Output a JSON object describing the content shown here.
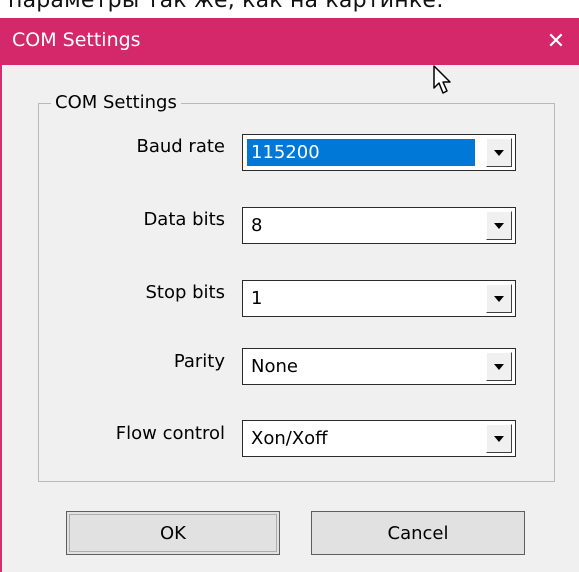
{
  "background_text": "параметры так же, как на картинке:",
  "window": {
    "title": "COM Settings",
    "close_glyph": "✕",
    "accent_color": "#d4286a"
  },
  "group": {
    "label": "COM Settings"
  },
  "fields": [
    {
      "label": "Baud rate",
      "value": "115200",
      "selected": true
    },
    {
      "label": "Data bits",
      "value": "8"
    },
    {
      "label": "Stop bits",
      "value": "1"
    },
    {
      "label": "Parity",
      "value": "None"
    },
    {
      "label": "Flow control",
      "value": "Xon/Xoff"
    }
  ],
  "buttons": {
    "ok_label": "OK",
    "cancel_label": "Cancel"
  },
  "icons": {
    "dropdown": "chevron-down-icon",
    "close": "close-icon",
    "cursor": "mouse-pointer-icon"
  }
}
